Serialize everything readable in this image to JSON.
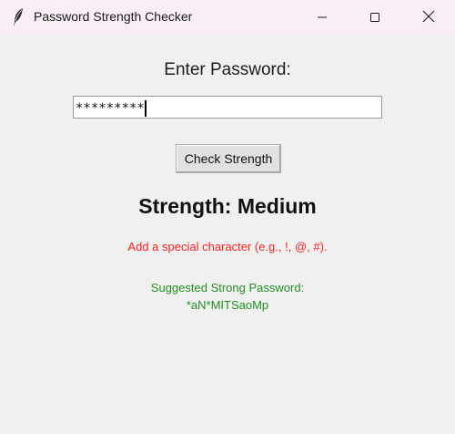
{
  "window": {
    "title": "Password Strength Checker",
    "icon": "feather-icon",
    "controls": {
      "minimize": "minimize-icon",
      "maximize": "maximize-icon",
      "close": "close-icon"
    }
  },
  "form": {
    "prompt": "Enter Password:",
    "password_value": "*********",
    "check_button_label": "Check Strength"
  },
  "result": {
    "strength_text": "Strength: Medium",
    "hint_text": "Add a special character (e.g., !, @, #).",
    "suggestion_title": "Suggested Strong Password:",
    "suggestion_value": "*aN*MITSaoMp"
  },
  "colors": {
    "hint": "#ff2020",
    "suggestion": "#238f23",
    "titlebar": "#f9eef5",
    "background": "#f0f0f0"
  }
}
